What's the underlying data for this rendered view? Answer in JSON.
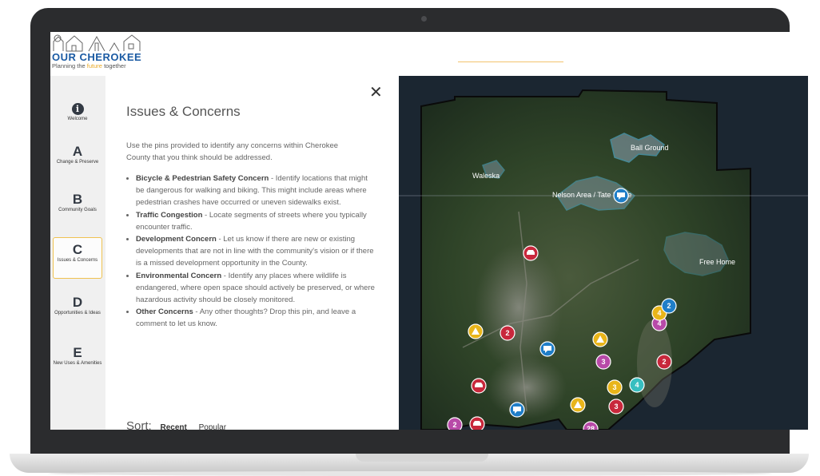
{
  "logo": {
    "title": "OUR CHEROKEE",
    "tag_before": "Planning the ",
    "tag_highlight": "future",
    "tag_after": " together"
  },
  "sidebar": {
    "items": [
      {
        "letter": "",
        "icon": "info-icon",
        "label": "Welcome"
      },
      {
        "letter": "A",
        "label": "Change & Preserve"
      },
      {
        "letter": "B",
        "label": "Community Goals"
      },
      {
        "letter": "C",
        "label": "Issues & Concerns",
        "active": true
      },
      {
        "letter": "D",
        "label": "Opportunities & Ideas"
      },
      {
        "letter": "E",
        "label": "New Uses & Amenities"
      }
    ]
  },
  "panel": {
    "close_icon": "close-icon",
    "title": "Issues & Concerns",
    "intro": "Use the pins provided to identify any concerns within Cherokee County that you think should be addressed.",
    "bullets": [
      {
        "title": "Bicycle & Pedestrian Safety Concern",
        "text": " - Identify locations that might be dangerous for walking and biking. This might include areas where pedestrian crashes have occurred or uneven sidewalks exist."
      },
      {
        "title": "Traffic Congestion",
        "text": " - Locate segments of streets where you typically encounter traffic."
      },
      {
        "title": "Development Concern",
        "text": " - Let us know if there are new or existing developments that are not in line with the community's vision or if there is a missed development opportunity in the County."
      },
      {
        "title": "Environmental Concern",
        "text": " - Identify any places where wildlife is endangered, where open space should actively be preserved, or where hazardous activity should be closely monitored."
      },
      {
        "title": "Other Concerns",
        "text": " - Any other thoughts? Drop this pin, and leave a comment to let us know."
      }
    ],
    "sort": {
      "label": "Sort:",
      "options": [
        "Recent",
        "Popular"
      ]
    }
  },
  "map": {
    "places": [
      "Ball Ground",
      "Waleska",
      "Nelson Area / Tate Ridge",
      "Free Home"
    ],
    "pin_colors": {
      "development": "#e8b51a",
      "traffic": "#c8283c",
      "environment": "#38bfc0",
      "other": "#1f7ec8",
      "bike_ped": "#b84aa8"
    },
    "pins": [
      {
        "type": "traffic",
        "icon": "car-icon",
        "label": ""
      },
      {
        "type": "traffic",
        "icon": "car-icon",
        "label": ""
      },
      {
        "type": "traffic",
        "icon": "car-icon",
        "label": ""
      },
      {
        "type": "other",
        "icon": "comment-icon",
        "label": ""
      },
      {
        "type": "other",
        "icon": "comment-icon",
        "label": ""
      },
      {
        "type": "other",
        "icon": "comment-icon",
        "label": ""
      },
      {
        "type": "development",
        "icon": "warning-icon",
        "label": ""
      },
      {
        "type": "development",
        "icon": "warning-icon",
        "label": ""
      },
      {
        "type": "development",
        "icon": "warning-icon",
        "label": ""
      },
      {
        "type": "traffic",
        "icon": "",
        "label": "2"
      },
      {
        "type": "traffic",
        "icon": "",
        "label": "2"
      },
      {
        "type": "traffic",
        "icon": "",
        "label": "3"
      },
      {
        "type": "bike_ped",
        "icon": "",
        "label": "3"
      },
      {
        "type": "bike_ped",
        "icon": "",
        "label": "2"
      },
      {
        "type": "bike_ped",
        "icon": "",
        "label": "4"
      },
      {
        "type": "environment",
        "icon": "",
        "label": "4"
      },
      {
        "type": "development",
        "icon": "",
        "label": "3"
      },
      {
        "type": "development",
        "icon": "",
        "label": "4"
      },
      {
        "type": "other",
        "icon": "",
        "label": "2"
      },
      {
        "type": "bike_ped",
        "icon": "",
        "label": "28"
      }
    ]
  }
}
